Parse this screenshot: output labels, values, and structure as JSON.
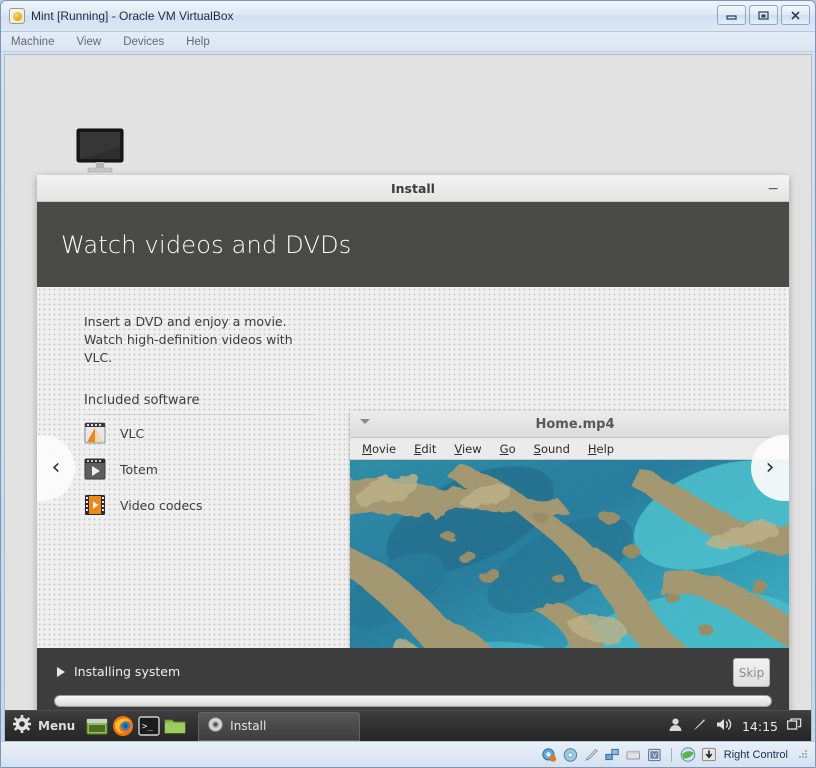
{
  "vbox": {
    "title": "Mint [Running] - Oracle VM VirtualBox",
    "app_icon": "virtualbox-icon",
    "menus": [
      {
        "label": "Machine",
        "name": "vbox-menu-machine"
      },
      {
        "label": "View",
        "name": "vbox-menu-view"
      },
      {
        "label": "Devices",
        "name": "vbox-menu-devices"
      },
      {
        "label": "Help",
        "name": "vbox-menu-help"
      }
    ],
    "window_buttons": [
      {
        "name": "minimize-button",
        "glyph": "minimize"
      },
      {
        "name": "restore-button",
        "glyph": "restore"
      },
      {
        "name": "close-button",
        "glyph": "close"
      }
    ],
    "statusbar": {
      "icons": [
        "hard-disk-icon",
        "optical-disk-icon",
        "floppy-disk-icon",
        "network-icon",
        "shared-folders-icon",
        "display-icon"
      ],
      "extra_icons": [
        "mouse-integration-icon",
        "host-key-icon"
      ],
      "host_key": "Right Control",
      "grip": "resize-grip"
    }
  },
  "desktop": {
    "icons": [
      {
        "name": "desktop-monitor-icon",
        "label": ""
      }
    ]
  },
  "install_window": {
    "title": "Install",
    "minimize_glyph": "−",
    "slide": {
      "heading": "Watch videos and DVDs",
      "description": "Insert a DVD and enjoy a movie. Watch high-definition videos with VLC.",
      "included_software_heading": "Included software",
      "software": [
        {
          "label": "VLC",
          "icon": "vlc-icon"
        },
        {
          "label": "Totem",
          "icon": "totem-icon"
        },
        {
          "label": "Video codecs",
          "icon": "video-codecs-icon"
        }
      ],
      "nav_prev_glyph": "‹",
      "nav_next_glyph": "›"
    },
    "video_preview": {
      "window_title": "Home.mp4",
      "window_menu_glyph": "▾",
      "menus": [
        {
          "label": "Movie",
          "accel": "M"
        },
        {
          "label": "Edit",
          "accel": "E"
        },
        {
          "label": "View",
          "accel": "V"
        },
        {
          "label": "Go",
          "accel": "G"
        },
        {
          "label": "Sound",
          "accel": "S"
        },
        {
          "label": "Help",
          "accel": "H"
        }
      ],
      "content_description": "aerial-coral-reef-photo"
    },
    "footer": {
      "status_text": "Installing system",
      "skip_label": "Skip",
      "progress_percent": 0
    }
  },
  "taskbar": {
    "menu_label": "Menu",
    "menu_icon": "gear-icon",
    "launchers": [
      {
        "name": "show-desktop-icon",
        "label": "Show Desktop"
      },
      {
        "name": "firefox-icon",
        "label": "Firefox Web Browser"
      },
      {
        "name": "terminal-icon",
        "label": "Terminal"
      },
      {
        "name": "files-icon",
        "label": "Files"
      }
    ],
    "tasks": [
      {
        "name": "task-install",
        "label": "Install",
        "icon": "install-disc-icon",
        "active": true
      }
    ],
    "tray": [
      {
        "name": "user-icon"
      },
      {
        "name": "update-manager-icon"
      },
      {
        "name": "volume-icon"
      }
    ],
    "clock": "14:15",
    "window_list_icon": "window-list-icon"
  },
  "colors": {
    "slide_header_bg": "#4a4a48",
    "slide_footer_bg": "#3d3d3d",
    "taskbar_bg": "#303030",
    "desktop_bg": "#e2e2e2",
    "reef_water": "#0d7d9b",
    "reef_coral": "#9c8f63"
  }
}
